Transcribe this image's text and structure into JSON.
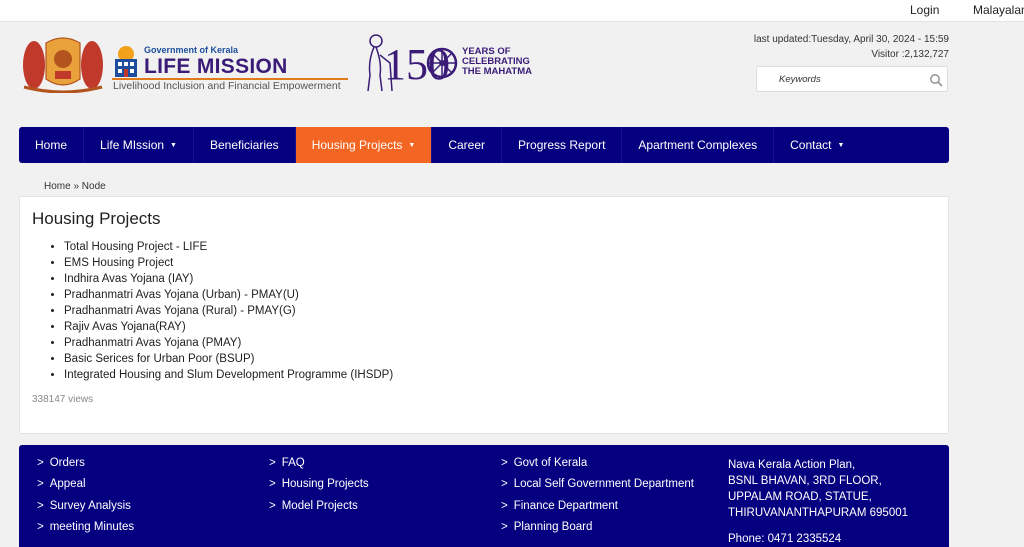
{
  "topbar": {
    "login": "Login",
    "language": "Malayalam"
  },
  "header": {
    "gov_label": "Government of Kerala",
    "title": "LIFE MISSION",
    "tagline": "Livelihood Inclusion and Financial Empowerment",
    "badge_number": "150",
    "badge_text_1": "YEARS OF",
    "badge_text_2": "CELEBRATING",
    "badge_text_3": "THE MAHATMA",
    "last_updated": "last updated:Tuesday, April 30, 2024 - 15:59",
    "visitor": "Visitor :2,132,727"
  },
  "search": {
    "placeholder": "Keywords",
    "icon": "search-icon"
  },
  "nav": {
    "items": [
      {
        "label": "Home"
      },
      {
        "label": "Life MIssion"
      },
      {
        "label": "Beneficiaries"
      },
      {
        "label": "Housing Projects"
      },
      {
        "label": "Career"
      },
      {
        "label": "Progress Report"
      },
      {
        "label": "Apartment Complexes"
      },
      {
        "label": "Contact"
      }
    ],
    "active": "Housing Projects",
    "dropdown_caret": "▼",
    "accent_color": "#f26522",
    "bar_color": "#05007f"
  },
  "breadcrumb": "Home » Node",
  "main": {
    "title": "Housing Projects",
    "items": [
      "Total Housing Project  -  LIFE",
      "EMS Housing Project",
      "Indhira Avas Yojana (IAY)",
      "Pradhanmatri Avas Yojana (Urban) - PMAY(U)",
      "Pradhanmatri Avas Yojana (Rural) - PMAY(G)",
      "Rajiv Avas Yojana(RAY)",
      "Pradhanmatri Avas Yojana (PMAY)",
      "Basic Serices for Urban Poor (BSUP)",
      "Integrated Housing and Slum Development Programme (IHSDP)"
    ],
    "views": "338147 views"
  },
  "footer": {
    "bullet": ">",
    "col1": [
      "Orders",
      "Appeal",
      "Survey Analysis",
      "meeting Minutes"
    ],
    "col2": [
      "FAQ",
      "Housing Projects",
      "Model Projects"
    ],
    "col3": [
      "Govt of Kerala",
      "Local Self Government Department",
      "Finance Department",
      "Planning Board"
    ],
    "address": {
      "line1": "Nava Kerala Action Plan,",
      "line2": "BSNL BHAVAN, 3RD FLOOR,",
      "line3": "UPPALAM ROAD, STATUE,",
      "line4": "THIRUVANANTHAPURAM 695001",
      "phone": "Phone: 0471 2335524"
    }
  }
}
